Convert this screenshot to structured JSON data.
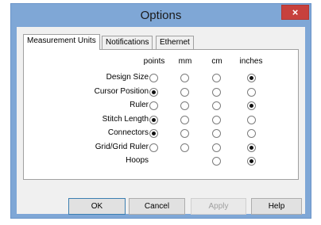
{
  "window": {
    "title": "Options",
    "close_glyph": "×"
  },
  "tabs": [
    {
      "label": "Measurement Units",
      "active": true
    },
    {
      "label": "Notifications",
      "active": false
    },
    {
      "label": "Ethernet",
      "active": false
    }
  ],
  "columns": [
    "points",
    "mm",
    "cm",
    "inches"
  ],
  "rows": [
    {
      "label": "Design Size",
      "selected": "inches",
      "available": [
        "points",
        "mm",
        "cm",
        "inches"
      ]
    },
    {
      "label": "Cursor Position",
      "selected": "points",
      "available": [
        "points",
        "mm",
        "cm",
        "inches"
      ]
    },
    {
      "label": "Ruler",
      "selected": "inches",
      "available": [
        "points",
        "mm",
        "cm",
        "inches"
      ]
    },
    {
      "label": "Stitch Length",
      "selected": "points",
      "available": [
        "points",
        "mm",
        "cm",
        "inches"
      ]
    },
    {
      "label": "Connectors",
      "selected": "points",
      "available": [
        "points",
        "mm",
        "cm",
        "inches"
      ]
    },
    {
      "label": "Grid/Grid Ruler",
      "selected": "inches",
      "available": [
        "points",
        "mm",
        "cm",
        "inches"
      ]
    },
    {
      "label": "Hoops",
      "selected": "inches",
      "available": [
        "cm",
        "inches"
      ]
    }
  ],
  "buttons": {
    "ok": "OK",
    "cancel": "Cancel",
    "apply": "Apply",
    "help": "Help"
  },
  "colors": {
    "titlebar": "#7fa7d6",
    "close": "#c7413d"
  }
}
